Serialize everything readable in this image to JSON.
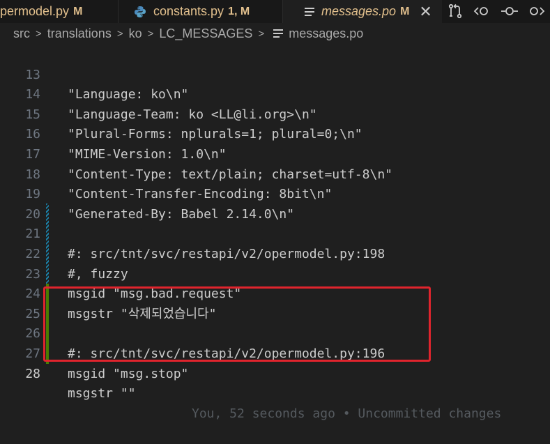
{
  "tabs": [
    {
      "name": "permodel.py",
      "status": "M",
      "icon": "python-icon"
    },
    {
      "name": "constants.py",
      "status": "1, M",
      "icon": "python-icon"
    },
    {
      "name": "messages.po",
      "status": "M",
      "icon": "po-file-icon",
      "active": true
    }
  ],
  "toolbar": {
    "icons": [
      "source-control-compare-icon",
      "go-back-icon",
      "go-dot-icon",
      "go-forward-icon"
    ]
  },
  "breadcrumb": [
    "src",
    "translations",
    "ko",
    "LC_MESSAGES",
    "messages.po"
  ],
  "editor": {
    "lines": [
      {
        "num": "13",
        "text": "\"Language: ko\\n\""
      },
      {
        "num": "14",
        "text": "\"Language-Team: ko <LL@li.org>\\n\""
      },
      {
        "num": "15",
        "text": "\"Plural-Forms: nplurals=1; plural=0;\\n\""
      },
      {
        "num": "16",
        "text": "\"MIME-Version: 1.0\\n\""
      },
      {
        "num": "17",
        "text": "\"Content-Type: text/plain; charset=utf-8\\n\""
      },
      {
        "num": "18",
        "text": "\"Content-Transfer-Encoding: 8bit\\n\""
      },
      {
        "num": "19",
        "text": "\"Generated-By: Babel 2.14.0\\n\""
      },
      {
        "num": "20",
        "text": ""
      },
      {
        "num": "21",
        "text": "#: src/tnt/svc/restapi/v2/opermodel.py:198"
      },
      {
        "num": "22",
        "text": "#, fuzzy"
      },
      {
        "num": "23",
        "text": "msgid \"msg.bad.request\""
      },
      {
        "num": "24",
        "text": "msgstr \"삭제되었습니다\""
      },
      {
        "num": "25",
        "text": ""
      },
      {
        "num": "26",
        "text": "#: src/tnt/svc/restapi/v2/opermodel.py:196"
      },
      {
        "num": "27",
        "text": "msgid \"msg.stop\""
      },
      {
        "num": "28",
        "text": "msgstr \"\""
      }
    ],
    "blame": "You, 52 seconds ago • Uncommitted changes"
  },
  "colors": {
    "modified": "#e2c08d",
    "highlight_border": "#e0242d",
    "gutter_added": "#487e02",
    "gutter_modified": "#1b81a8"
  }
}
